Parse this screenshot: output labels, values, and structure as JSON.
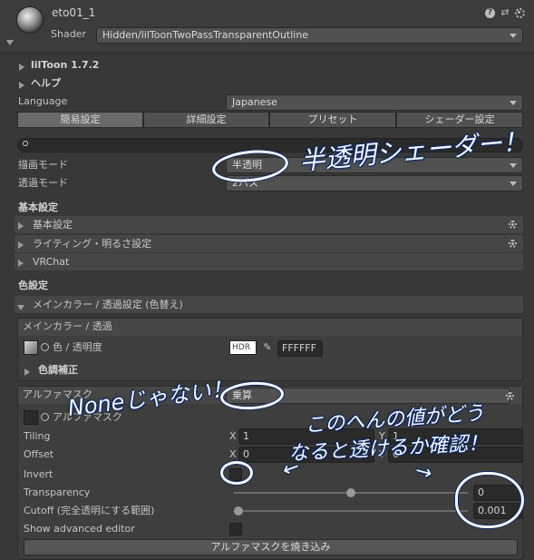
{
  "header": {
    "material_name": "eto01_1",
    "shader_label": "Shader",
    "shader_value": "Hidden/lilToonTwoPassTransparentOutline",
    "help_icon": "help-icon",
    "preset_icon": "sliders-icon",
    "settings_icon": "gear-icon"
  },
  "liltoon": {
    "version": "lilToon 1.7.2",
    "help": "ヘルプ",
    "language_label": "Language",
    "language_value": "Japanese",
    "tabs": [
      "簡易設定",
      "詳細設定",
      "プリセット",
      "シェーダー設定"
    ]
  },
  "search": {
    "placeholder": ""
  },
  "render": {
    "draw_mode_label": "描画モード",
    "draw_mode_value": "半透明",
    "transparent_mode_label": "透過モード",
    "transparent_mode_value": "2パス"
  },
  "basic": {
    "heading": "基本設定",
    "folds": [
      "基本設定",
      "ライティング・明るさ設定",
      "VRChat"
    ]
  },
  "color": {
    "heading": "色設定",
    "fold": "メインカラー / 透過設定 (色替え)",
    "main_box_title": "メインカラー / 透過",
    "color_label": "色 / 透明度",
    "hdr_label": "HDR",
    "hex_value": "FFFFFF",
    "tone_label": "色調補正"
  },
  "alphamask": {
    "title": "アルファマスク",
    "mode_value": "乗算",
    "texture_label": "アルファマスク",
    "tiling_label": "Tiling",
    "tiling_x_label": "X",
    "tiling_x": "1",
    "tiling_y_label": "Y",
    "tiling_y": "1",
    "offset_label": "Offset",
    "offset_x_label": "X",
    "offset_x": "0",
    "offset_y_label": "Y",
    "offset_y": "0",
    "invert_label": "Invert",
    "transparency_label": "Transparency",
    "transparency_value": "0",
    "transparency_level": 0.5,
    "cutoff_label": "Cutoff (完全透明にする範囲)",
    "cutoff_value": "0.001",
    "cutoff_level": 0.001,
    "advanced_label": "Show advanced editor",
    "bake_button": "アルファマスクを焼き込み"
  },
  "annotations": {
    "shader_note": "半透明シェーダー！",
    "none_note": "Noneじゃない！",
    "note_line1": "このへんの値がどう",
    "note_line2": "なると透けるか確認！",
    "arrow_left": "←",
    "arrow_right": "→"
  },
  "colors": {
    "background": "#383838",
    "annotation_ink": "#f4f8ff",
    "annotation_outline": "#0f2a63"
  }
}
